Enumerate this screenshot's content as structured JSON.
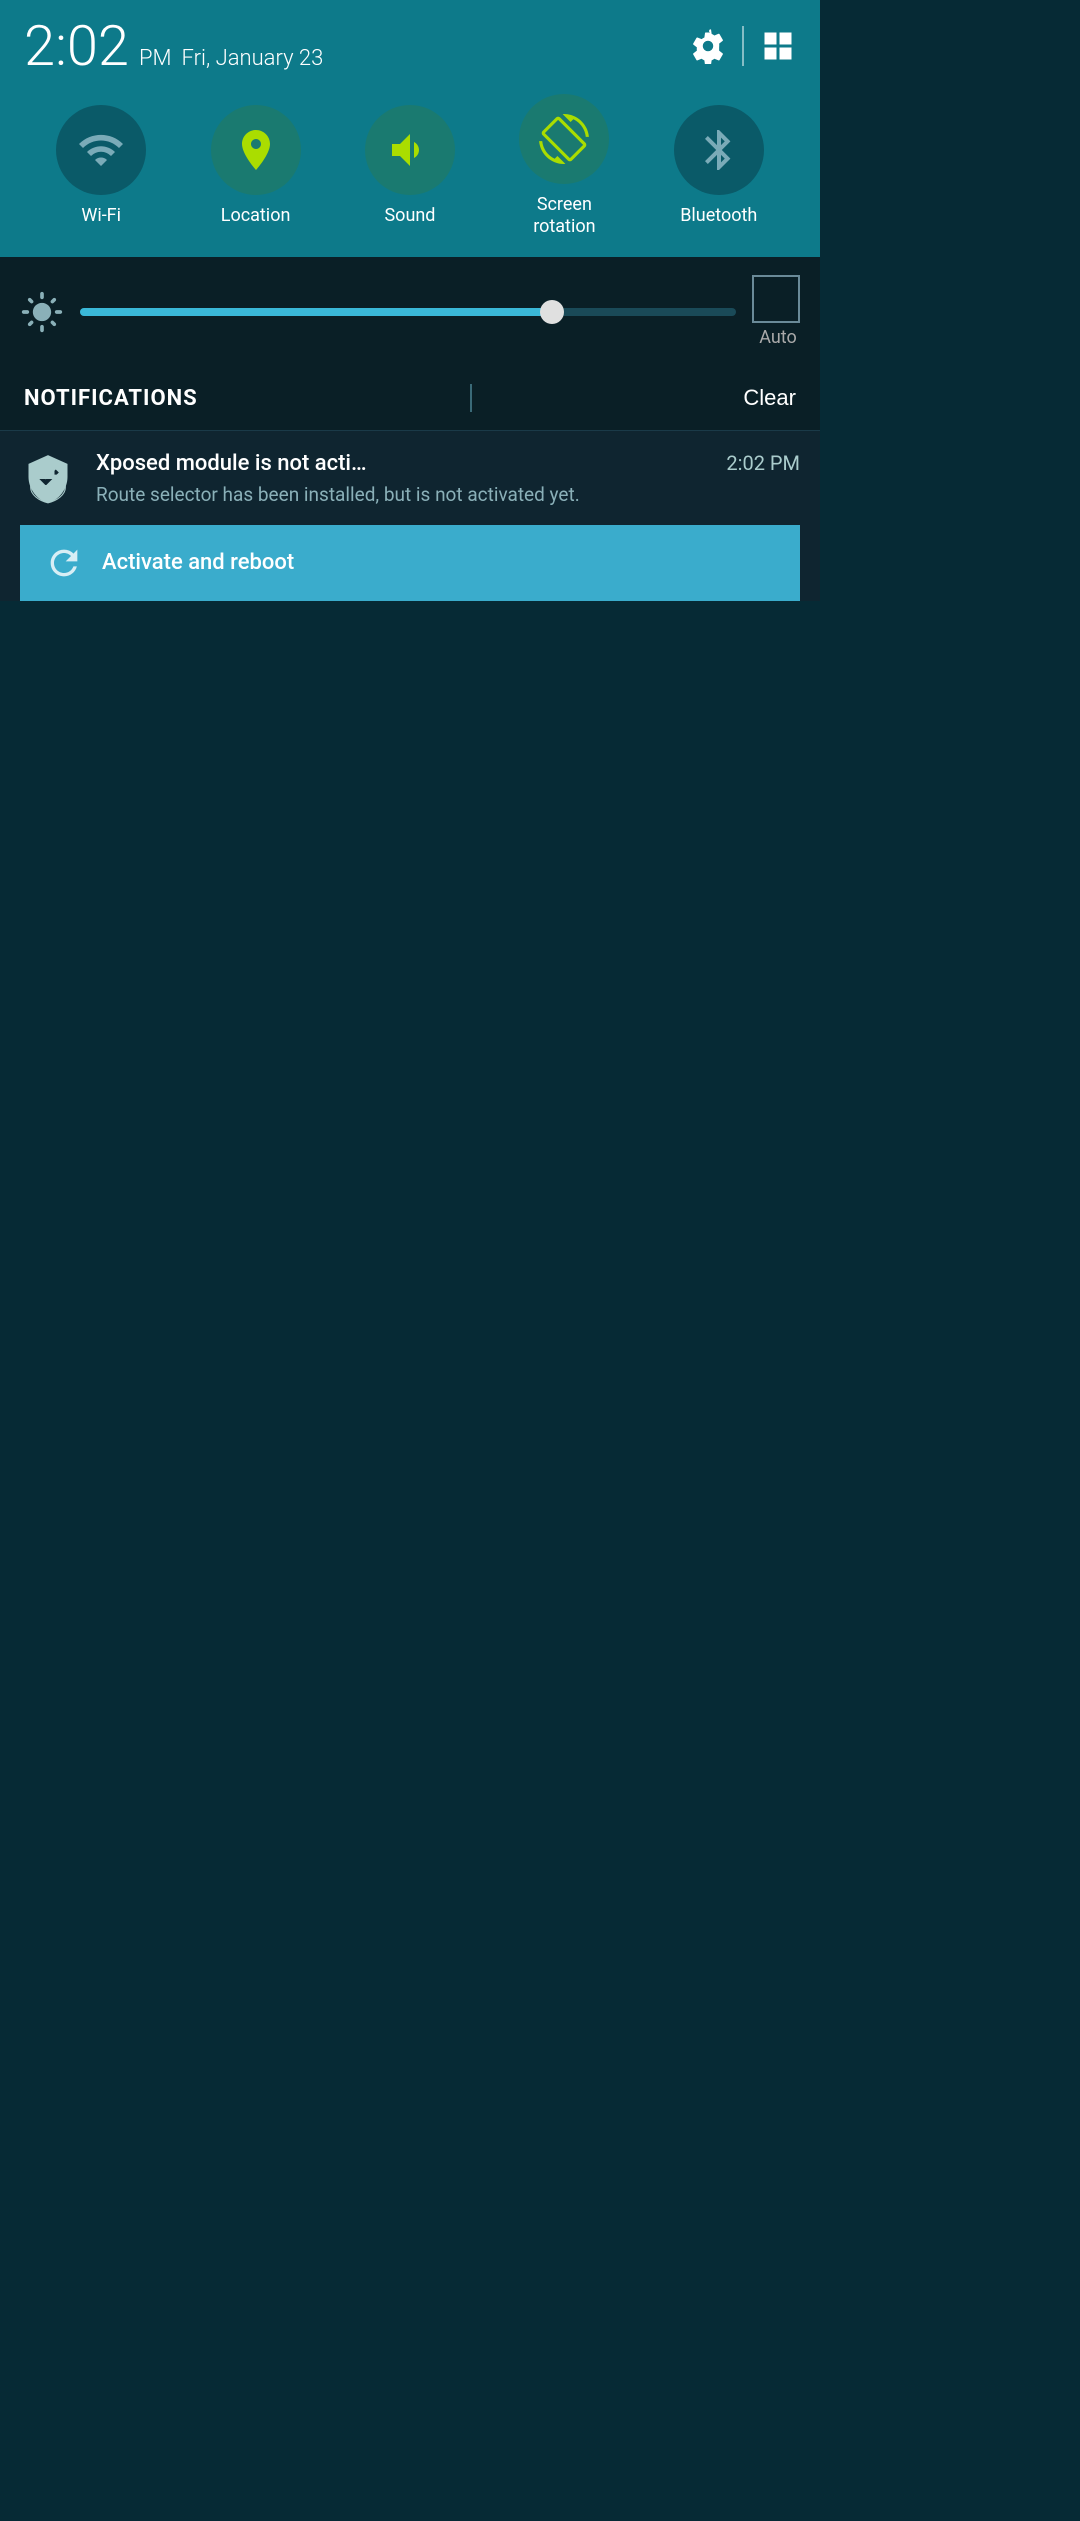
{
  "statusBar": {
    "time": "2:02",
    "ampm": "PM",
    "date": "Fri, January 23"
  },
  "toggles": [
    {
      "id": "wifi",
      "label": "Wi-Fi",
      "active": false,
      "icon": "wifi"
    },
    {
      "id": "location",
      "label": "Location",
      "active": true,
      "icon": "location"
    },
    {
      "id": "sound",
      "label": "Sound",
      "active": true,
      "icon": "sound"
    },
    {
      "id": "screen-rotation",
      "label": "Screen\nrotation",
      "active": true,
      "icon": "screen-rotation"
    },
    {
      "id": "bluetooth",
      "label": "Bluetooth",
      "active": false,
      "icon": "bluetooth"
    }
  ],
  "brightness": {
    "fillPercent": 72,
    "autoLabel": "Auto"
  },
  "notifications": {
    "title": "NOTIFICATIONS",
    "clearLabel": "Clear",
    "items": [
      {
        "appTitle": "Xposed module is not acti…",
        "time": "2:02 PM",
        "body": "Route selector has been installed, but is not activated yet.",
        "action": "Activate and reboot"
      }
    ]
  }
}
